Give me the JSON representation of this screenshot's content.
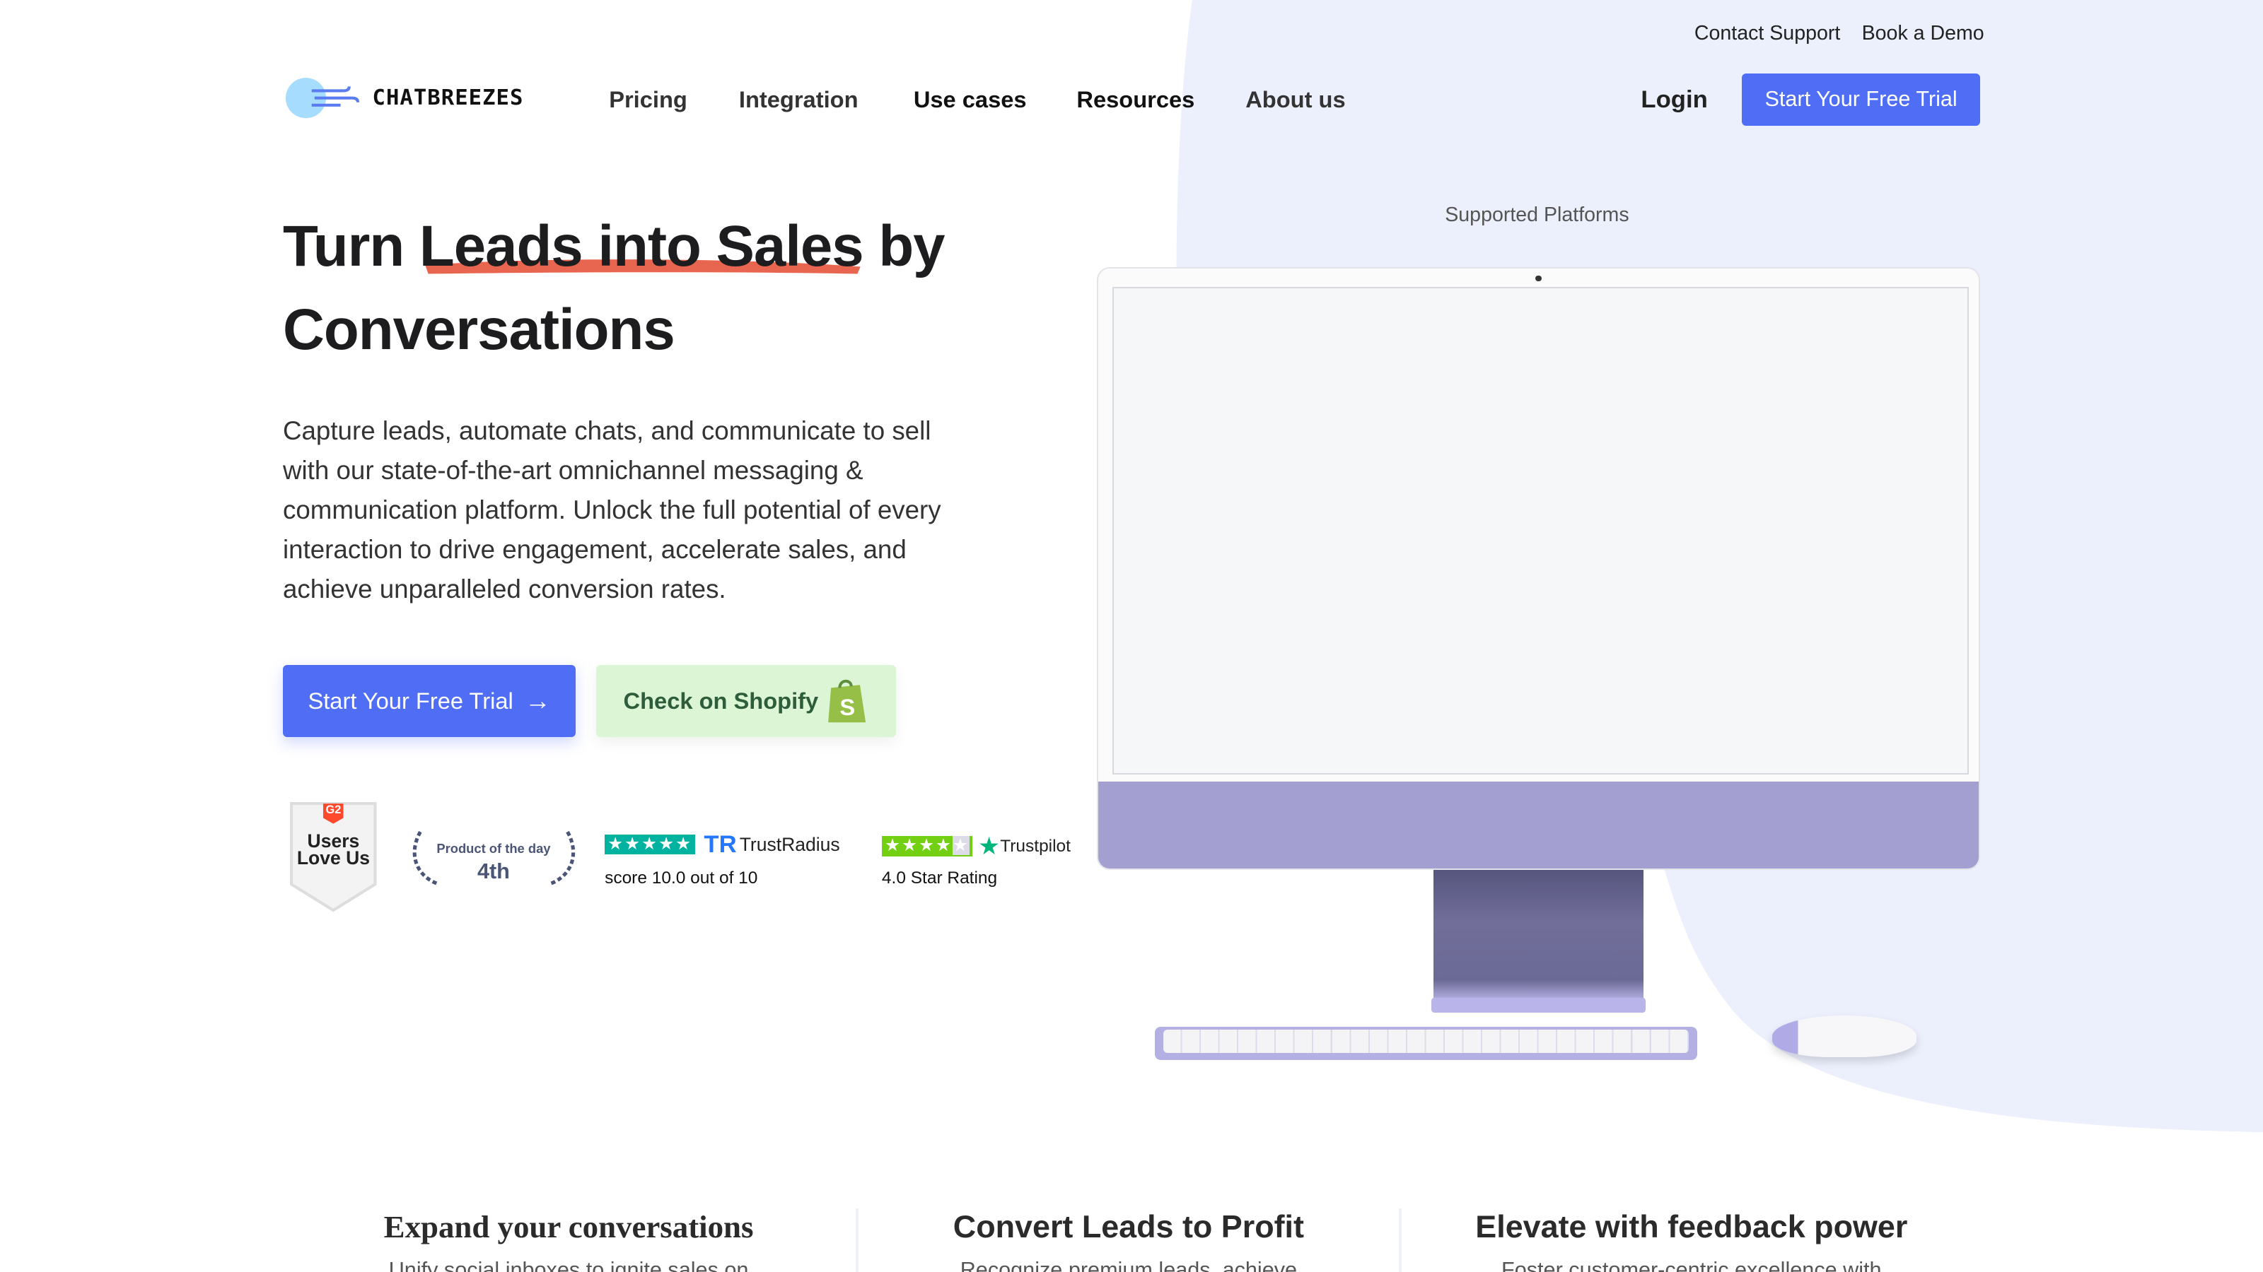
{
  "top_links": {
    "contact_support": "Contact Support",
    "book_demo": "Book a Demo"
  },
  "brand": {
    "name": "CHATBREEZES"
  },
  "nav": {
    "items": [
      "Pricing",
      "Integration",
      "Use cases",
      "Resources",
      "About us"
    ],
    "login": "Login",
    "cta": "Start Your Free Trial"
  },
  "hero": {
    "title_part1": "Turn ",
    "title_highlight": "Leads into Sales",
    "title_part2": " by",
    "title_line2": "Conversations",
    "description": "Capture leads, automate chats, and communicate to sell with our state-of-the-art omnichannel messaging & communication platform. Unlock the full potential of every interaction to drive engagement, accelerate sales, and achieve unparalleled conversion rates.",
    "primary_button": "Start Your Free Trial",
    "shopify_button": "Check on Shopify"
  },
  "badges": {
    "g2": {
      "text": "Users Love Us",
      "logo": "G2"
    },
    "product_of_day": {
      "label": "Product of the day",
      "rank": "4th"
    },
    "trustradius": {
      "brand": "TrustRadius",
      "score": "score 10.0 out of 10",
      "stars": 5
    },
    "trustpilot": {
      "brand": "Trustpilot",
      "rating": "4.0 Star Rating",
      "stars": 4
    }
  },
  "platforms": {
    "label": "Supported Platforms"
  },
  "features": [
    {
      "title": "Expand your conversations",
      "desc": "Unify social inboxes to ignite sales on"
    },
    {
      "title": "Convert Leads to Profit",
      "desc": "Recognize premium leads, achieve"
    },
    {
      "title": "Elevate with feedback power",
      "desc": "Foster customer-centric excellence with"
    }
  ],
  "colors": {
    "accent": "#4f6df5",
    "highlight": "#e8664f",
    "background_blob": "#ecf0fd",
    "shopify_bg": "#dcf5d4",
    "monitor": "#a39fd0"
  }
}
